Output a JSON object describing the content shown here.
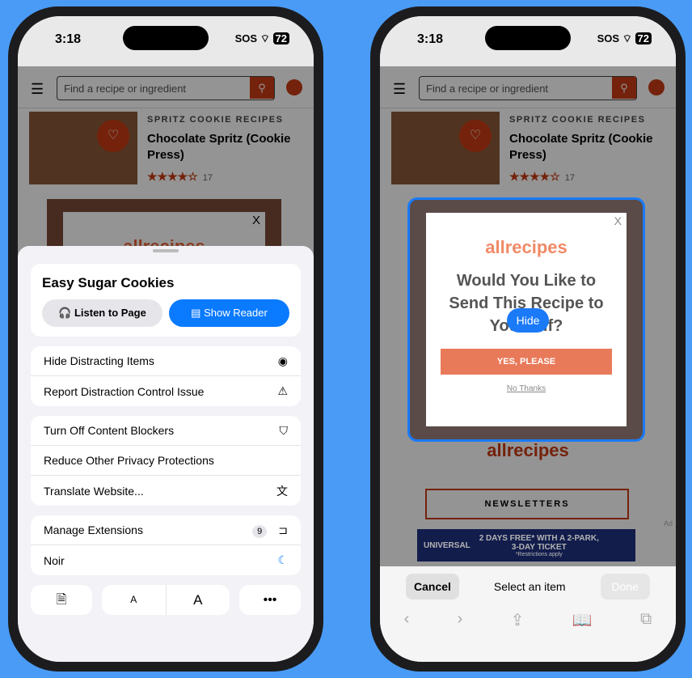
{
  "status": {
    "time": "3:18",
    "sos": "SOS",
    "battery": "72"
  },
  "site": {
    "search_placeholder": "Find a recipe or ingredient",
    "category": "SPRITZ COOKIE RECIPES",
    "title": "Chocolate Spritz (Cookie Press)",
    "stars": "★★★★☆",
    "rating_count": "17",
    "logo": "allrecipes",
    "close": "X"
  },
  "sheet": {
    "page_title": "Easy Sugar Cookies",
    "listen": "Listen to Page",
    "reader": "Show Reader",
    "groups": [
      [
        {
          "label": "Hide Distracting Items",
          "icon": "eye-slash-icon",
          "g": "◉"
        },
        {
          "label": "Report Distraction Control Issue",
          "icon": "report-icon",
          "g": "⚠"
        }
      ],
      [
        {
          "label": "Turn Off Content Blockers",
          "icon": "shield-slash-icon",
          "g": "⛉"
        },
        {
          "label": "Reduce Other Privacy Protections",
          "icon": "",
          "g": ""
        },
        {
          "label": "Translate Website...",
          "icon": "translate-icon",
          "g": "文"
        }
      ],
      [
        {
          "label": "Manage Extensions",
          "icon": "extension-icon",
          "g": "⊐",
          "badge": "9"
        },
        {
          "label": "Noir",
          "icon": "noir-moon-icon",
          "g": "☾"
        }
      ]
    ],
    "small_a": "A",
    "large_a": "A",
    "more": "•••"
  },
  "popup": {
    "headline": "Would You Like to Send This Recipe to Yourself?",
    "yes": "YES, PLEASE",
    "no": "No Thanks",
    "hide": "Hide"
  },
  "footer": {
    "newsletters": "NEWSLETTERS",
    "ad_label": "Ad",
    "ad_brand": "UNIVERSAL",
    "ad_text": "2 DAYS FREE* WITH A 2-PARK, 3-DAY TICKET",
    "ad_small": "*Restrictions apply"
  },
  "select": {
    "cancel": "Cancel",
    "prompt": "Select an item",
    "done": "Done"
  },
  "colors": {
    "accent": "#0a7aff",
    "brand": "#c83c14",
    "background": "#4a9bf6"
  }
}
